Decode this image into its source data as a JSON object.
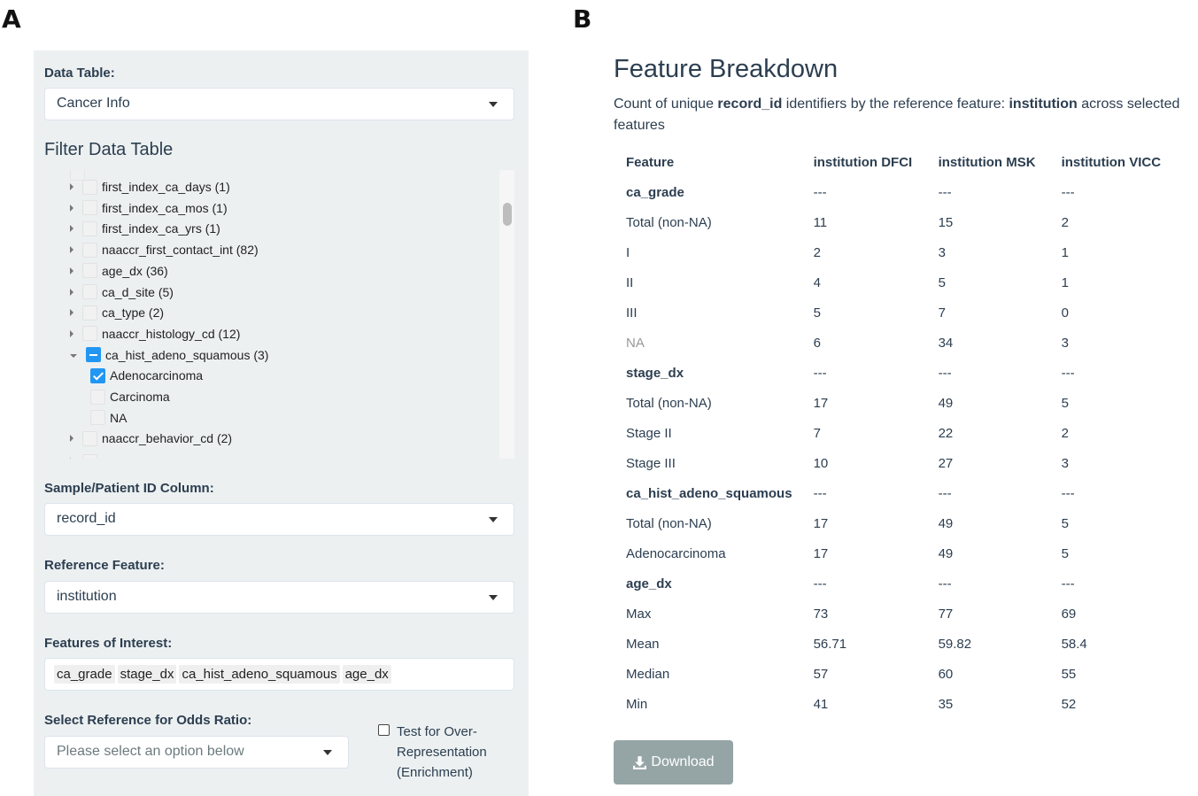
{
  "panel_letters": {
    "a": "A",
    "b": "B"
  },
  "sidebar": {
    "data_table_label": "Data Table:",
    "data_table_value": "Cancer Info",
    "filter_title": "Filter Data Table",
    "tree": [
      {
        "label": "first_index_ca_days (1)",
        "level": 0,
        "state": "unchecked",
        "expanded": false
      },
      {
        "label": "first_index_ca_mos (1)",
        "level": 0,
        "state": "unchecked",
        "expanded": false
      },
      {
        "label": "first_index_ca_yrs (1)",
        "level": 0,
        "state": "unchecked",
        "expanded": false
      },
      {
        "label": "naaccr_first_contact_int (82)",
        "level": 0,
        "state": "unchecked",
        "expanded": false
      },
      {
        "label": "age_dx (36)",
        "level": 0,
        "state": "unchecked",
        "expanded": false
      },
      {
        "label": "ca_d_site (5)",
        "level": 0,
        "state": "unchecked",
        "expanded": false
      },
      {
        "label": "ca_type (2)",
        "level": 0,
        "state": "unchecked",
        "expanded": false
      },
      {
        "label": "naaccr_histology_cd (12)",
        "level": 0,
        "state": "unchecked",
        "expanded": false
      },
      {
        "label": "ca_hist_adeno_squamous (3)",
        "level": 0,
        "state": "partial",
        "expanded": true
      },
      {
        "label": "Adenocarcinoma",
        "level": 1,
        "state": "checked"
      },
      {
        "label": "Carcinoma",
        "level": 1,
        "state": "unchecked"
      },
      {
        "label": "NA",
        "level": 1,
        "state": "unchecked"
      },
      {
        "label": "naaccr_behavior_cd (2)",
        "level": 0,
        "state": "unchecked",
        "expanded": false
      }
    ],
    "id_column_label": "Sample/Patient ID Column:",
    "id_column_value": "record_id",
    "reference_label": "Reference Feature:",
    "reference_value": "institution",
    "features_label": "Features of Interest:",
    "features": [
      "ca_grade",
      "stage_dx",
      "ca_hist_adeno_squamous",
      "age_dx"
    ],
    "odds_label": "Select Reference for Odds Ratio:",
    "odds_placeholder": "Please select an option below",
    "enrichment_label": "Test for Over-Representation (Enrichment)",
    "enrichment_checked": false
  },
  "breakdown": {
    "title": "Feature Breakdown",
    "desc_pre": "Count of unique ",
    "desc_id": "record_id",
    "desc_mid": " identifiers by the reference feature: ",
    "desc_ref": "institution",
    "desc_post": " across selected features",
    "columns": [
      "Feature",
      "institution DFCI",
      "institution MSK",
      "institution VICC"
    ],
    "rows": [
      {
        "cells": [
          "ca_grade",
          "---",
          "---",
          "---"
        ],
        "head": true
      },
      {
        "cells": [
          "Total (non-NA)",
          "11",
          "15",
          "2"
        ]
      },
      {
        "cells": [
          "I",
          "2",
          "3",
          "1"
        ]
      },
      {
        "cells": [
          "II",
          "4",
          "5",
          "1"
        ]
      },
      {
        "cells": [
          "III",
          "5",
          "7",
          "0"
        ]
      },
      {
        "cells": [
          "NA",
          "6",
          "34",
          "3"
        ],
        "na": true
      },
      {
        "cells": [
          "stage_dx",
          "---",
          "---",
          "---"
        ],
        "head": true
      },
      {
        "cells": [
          "Total (non-NA)",
          "17",
          "49",
          "5"
        ]
      },
      {
        "cells": [
          "Stage II",
          "7",
          "22",
          "2"
        ]
      },
      {
        "cells": [
          "Stage III",
          "10",
          "27",
          "3"
        ]
      },
      {
        "cells": [
          "ca_hist_adeno_squamous",
          "---",
          "---",
          "---"
        ],
        "head": true
      },
      {
        "cells": [
          "Total (non-NA)",
          "17",
          "49",
          "5"
        ]
      },
      {
        "cells": [
          "Adenocarcinoma",
          "17",
          "49",
          "5"
        ]
      },
      {
        "cells": [
          "age_dx",
          "---",
          "---",
          "---"
        ],
        "head": true
      },
      {
        "cells": [
          "Max",
          "73",
          "77",
          "69"
        ]
      },
      {
        "cells": [
          "Mean",
          "56.71",
          "59.82",
          "58.4"
        ]
      },
      {
        "cells": [
          "Median",
          "57",
          "60",
          "55"
        ]
      },
      {
        "cells": [
          "Min",
          "41",
          "35",
          "52"
        ]
      }
    ],
    "download_label": "Download",
    "download_icon": "download-icon",
    "colors": {
      "button": "#95a5a6",
      "checkbox": "#2196f3",
      "text": "#2c3e50"
    }
  }
}
